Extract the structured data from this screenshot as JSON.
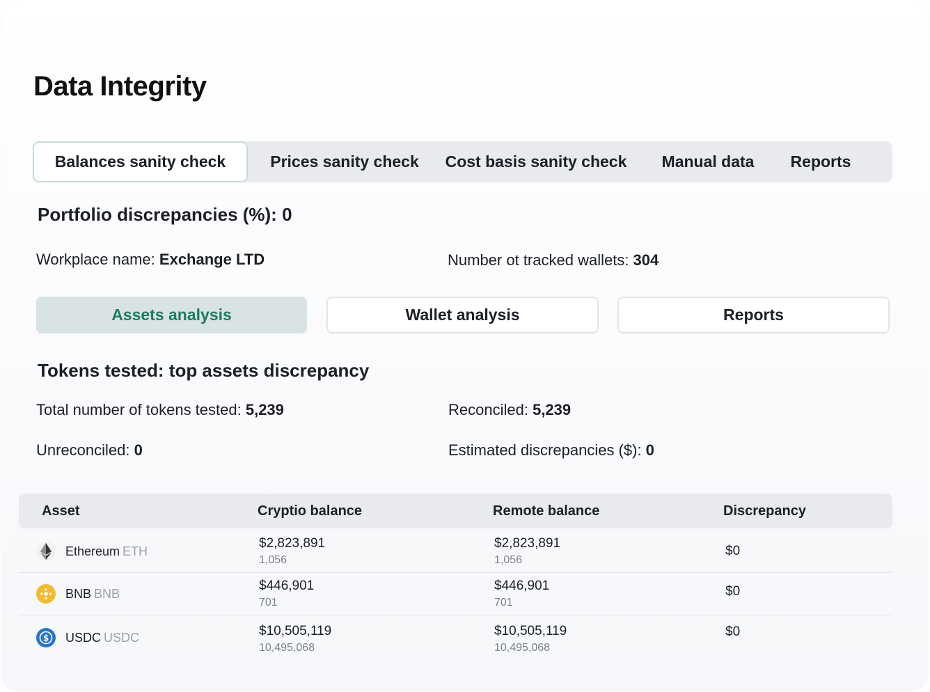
{
  "page": {
    "title": "Data Integrity"
  },
  "tabs": [
    {
      "label": "Balances sanity check",
      "active": true
    },
    {
      "label": "Prices sanity check",
      "active": false
    },
    {
      "label": "Cost basis sanity check",
      "active": false
    },
    {
      "label": "Manual data",
      "active": false
    },
    {
      "label": "Reports",
      "active": false
    }
  ],
  "portfolio": {
    "heading": "Portfolio discrepancies (%): 0",
    "workplace_label": "Workplace name: ",
    "workplace_value": "Exchange LTD",
    "wallets_label": "Number ot tracked wallets: ",
    "wallets_value": "304"
  },
  "subtabs": [
    {
      "label": "Assets analysis",
      "active": true
    },
    {
      "label": "Wallet analysis",
      "active": false
    },
    {
      "label": "Reports",
      "active": false
    }
  ],
  "tokens": {
    "heading": "Tokens tested: top assets discrepancy",
    "total_label": "Total number of tokens tested: ",
    "total_value": "5,239",
    "reconciled_label": "Reconciled: ",
    "reconciled_value": "5,239",
    "unreconciled_label": "Unreconciled: ",
    "unreconciled_value": "0",
    "estimated_label": "Estimated discrepancies ($): ",
    "estimated_value": "0"
  },
  "table": {
    "headers": [
      "Asset",
      "Cryptio balance",
      "Remote balance",
      "Discrepancy"
    ],
    "rows": [
      {
        "name": "Ethereum",
        "symbol": "ETH",
        "icon": "ethereum-icon",
        "icon_color": "#f0f0f2",
        "cryptio_value": "$2,823,891",
        "cryptio_qty": "1,056",
        "remote_value": "$2,823,891",
        "remote_qty": "1,056",
        "discrepancy": "$0"
      },
      {
        "name": "BNB",
        "symbol": "BNB",
        "icon": "bnb-icon",
        "icon_color": "#f3ba2f",
        "cryptio_value": "$446,901",
        "cryptio_qty": "701",
        "remote_value": "$446,901",
        "remote_qty": "701",
        "discrepancy": "$0"
      },
      {
        "name": "USDC",
        "symbol": "USDC",
        "icon": "usdc-icon",
        "icon_color": "#2775ca",
        "cryptio_value": "$10,505,119",
        "cryptio_qty": "10,495,068",
        "remote_value": "$10,505,119",
        "remote_qty": "10,495,068",
        "discrepancy": "$0"
      }
    ]
  },
  "colors": {
    "accent_green": "#1b7d63",
    "active_subtab_bg": "#d9e3e4",
    "tab_bar_bg": "#e8eaee"
  }
}
